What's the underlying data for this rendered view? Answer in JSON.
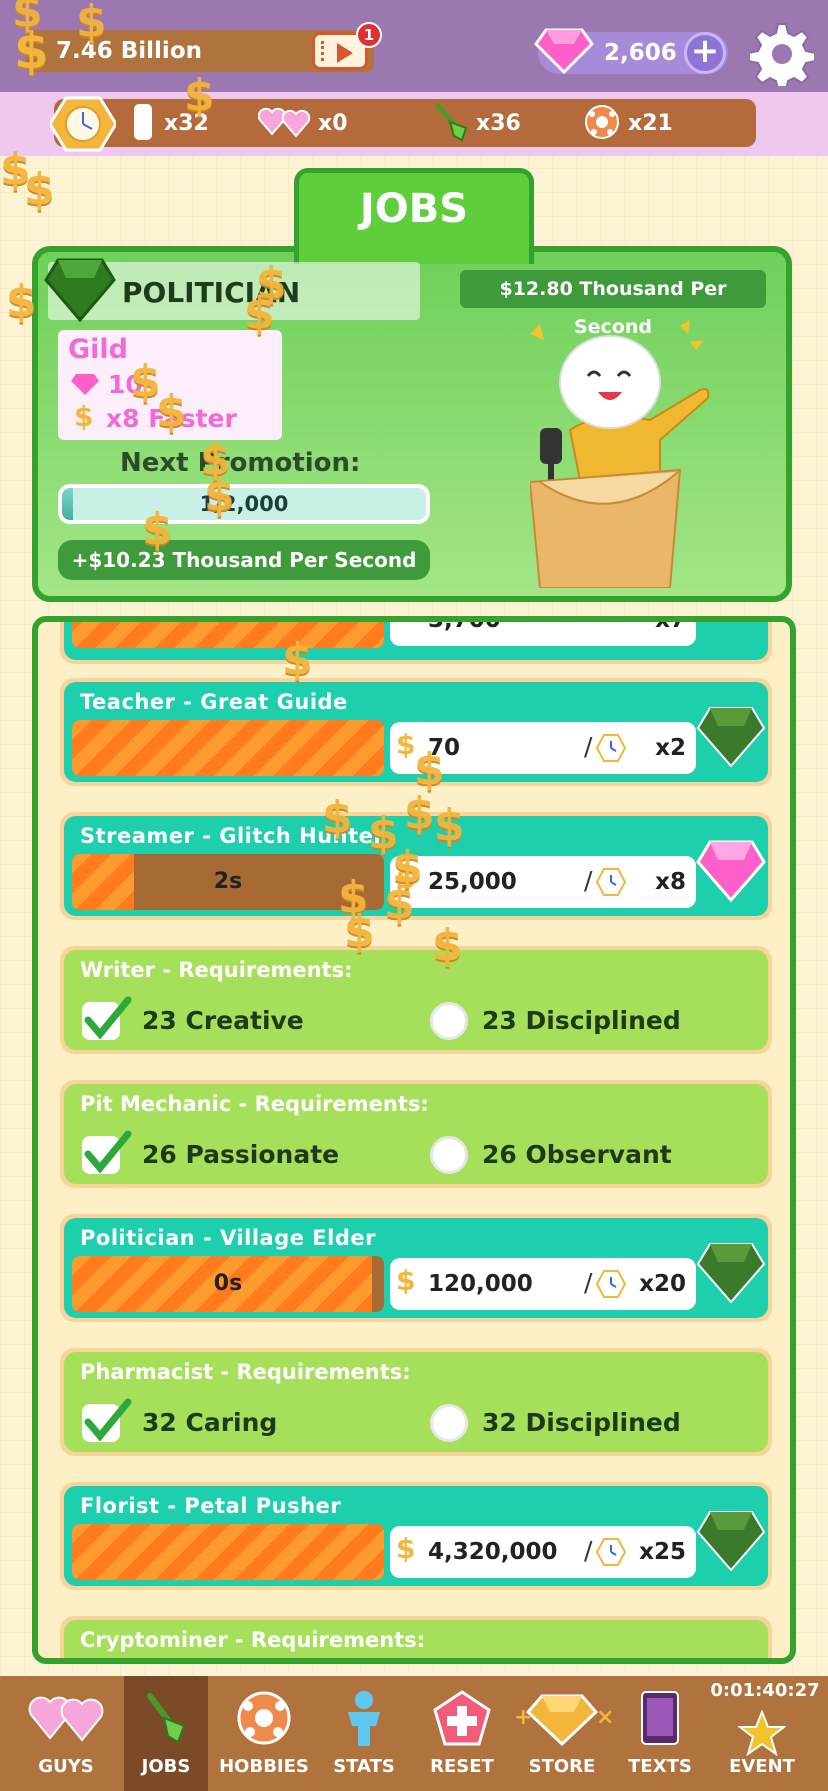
{
  "topbar": {
    "money": "7.46 Billion",
    "notification_count": "1",
    "gems": "2,606",
    "plus_label": "+"
  },
  "resources": [
    {
      "icon": "ticket-icon",
      "value": "x32"
    },
    {
      "icon": "hearts-icon",
      "value": "x0"
    },
    {
      "icon": "shovel-icon",
      "value": "x36"
    },
    {
      "icon": "ball-icon",
      "value": "x21"
    }
  ],
  "jobs_header": {
    "tab_title": "JOBS",
    "current_job": "POLITICIAN",
    "rate": "$12.80 Thousand Per Second",
    "gild_label": "Gild",
    "gild_cost": "10",
    "gild_bonus": "x8 Faster",
    "next_promotion_label": "Next Promotion:",
    "promotion_progress_text": "1/2,000",
    "promotion_progress_fraction": 0.0005,
    "bonus_rate": "+$10.23 Thousand Per Second"
  },
  "list": {
    "top_partial": {
      "cost": "3,700",
      "mult": "x7"
    },
    "rows": [
      {
        "type": "active",
        "title": "Teacher - Great Guide",
        "timer": "",
        "progress": 1.0,
        "cost": "70",
        "mult": "x2",
        "badge": "leaf"
      },
      {
        "type": "active",
        "title": "Streamer - Glitch Hunter",
        "timer": "2s",
        "progress": 0.2,
        "cost": "25,000",
        "mult": "x8",
        "badge": "gem"
      },
      {
        "type": "req",
        "title": "Writer - Requirements:",
        "req1": "23 Creative",
        "req1_met": true,
        "req2": "23 Disciplined",
        "req2_met": false
      },
      {
        "type": "req",
        "title": "Pit Mechanic - Requirements:",
        "req1": "26 Passionate",
        "req1_met": true,
        "req2": "26 Observant",
        "req2_met": false
      },
      {
        "type": "active",
        "title": "Politician - Village Elder",
        "timer": "0s",
        "progress": 0.96,
        "cost": "120,000",
        "mult": "x20",
        "badge": "leaf"
      },
      {
        "type": "req",
        "title": "Pharmacist - Requirements:",
        "req1": "32 Caring",
        "req1_met": true,
        "req2": "32 Disciplined",
        "req2_met": false
      },
      {
        "type": "active",
        "title": "Florist - Petal Pusher",
        "timer": "",
        "progress": 1.0,
        "cost": "4,320,000",
        "mult": "x25",
        "badge": "leaf"
      },
      {
        "type": "req",
        "title": "Cryptominer - Requirements:"
      }
    ]
  },
  "nav": {
    "timer": "0:01:40:27",
    "items": [
      {
        "label": "GUYS",
        "icon": "hearts-icon"
      },
      {
        "label": "JOBS",
        "icon": "shovel-icon",
        "selected": true
      },
      {
        "label": "HOBBIES",
        "icon": "ball-icon"
      },
      {
        "label": "STATS",
        "icon": "person-icon"
      },
      {
        "label": "RESET",
        "icon": "reset-icon"
      },
      {
        "label": "STORE",
        "icon": "gem-icon"
      },
      {
        "label": "TEXTS",
        "icon": "phone-icon"
      },
      {
        "label": "EVENT",
        "icon": "star-icon"
      }
    ]
  },
  "colors": {
    "topbar": "#9b78b0",
    "resbar": "#eec8ef",
    "green_frame": "#34a22c",
    "teal_row": "#1ecfae",
    "lime_row": "#a6e05a",
    "orange_bar": "#ff9a2e",
    "nav": "#b0733d"
  }
}
